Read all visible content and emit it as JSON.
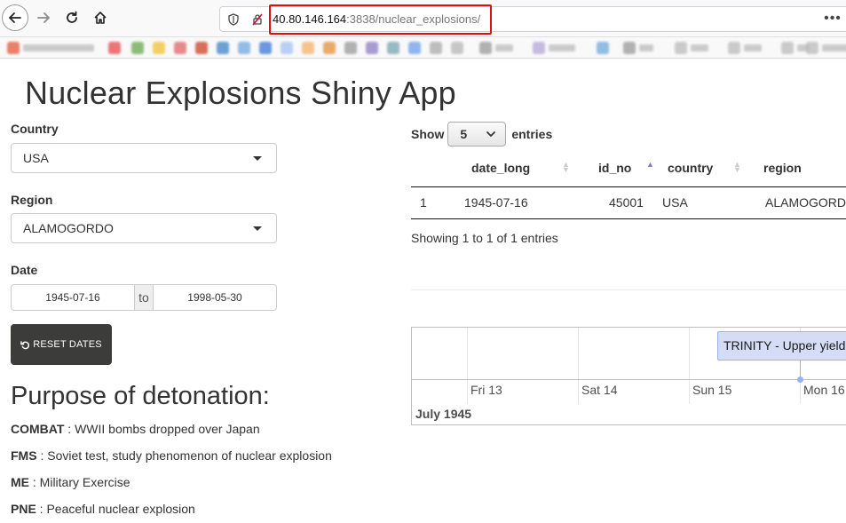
{
  "browser": {
    "url_host": "40.80.146.164",
    "url_rest": ":3838/nuclear_explosions/",
    "overflow": "•••"
  },
  "app": {
    "title": "Nuclear Explosions Shiny App",
    "country_label": "Country",
    "country_value": "USA",
    "region_label": "Region",
    "region_value": "ALAMOGORDO",
    "date_label": "Date",
    "date_start": "1945-07-16",
    "date_sep": "to",
    "date_end": "1998-05-30",
    "reset_label": "RESET DATES",
    "purpose_title": "Purpose of detonation:",
    "purposes": [
      {
        "code": "COMBAT",
        "desc": " : WWII bombs dropped over Japan"
      },
      {
        "code": "FMS",
        "desc": " : Soviet test, study phenomenon of nuclear explosion"
      },
      {
        "code": "ME",
        "desc": " : Military Exercise"
      },
      {
        "code": "PNE",
        "desc": " : Peaceful nuclear explosion"
      }
    ]
  },
  "table": {
    "show_label": "Show",
    "length_value": "5",
    "entries_label": "entries",
    "columns": [
      "date_long",
      "id_no",
      "country",
      "region"
    ],
    "rows": [
      {
        "idx": "1",
        "date_long": "1945-07-16",
        "id_no": "45001",
        "country": "USA",
        "region": "ALAMOGORDO"
      }
    ],
    "info": "Showing 1 to 1 of 1 entries"
  },
  "timeline": {
    "days": [
      "Fri 13",
      "Sat 14",
      "Sun 15",
      "Mon 16"
    ],
    "month": "July 1945",
    "item_label": "TRINITY - Upper yield: "
  }
}
